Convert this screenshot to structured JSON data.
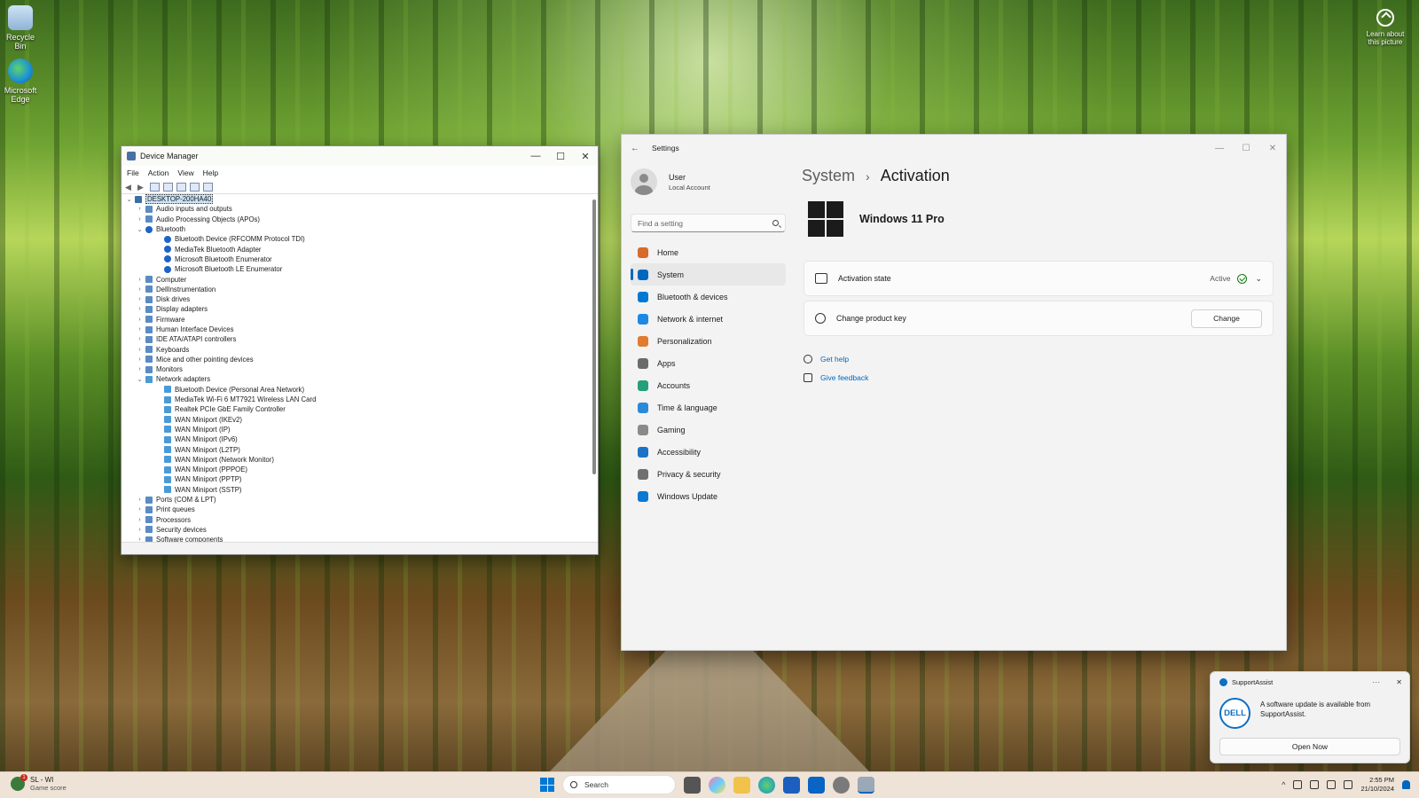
{
  "desktop": {
    "icons": [
      {
        "label": "Recycle Bin"
      },
      {
        "label": "Microsoft Edge"
      }
    ],
    "learn_label": "Learn about this picture"
  },
  "device_manager": {
    "title": "Device Manager",
    "menu": [
      "File",
      "Action",
      "View",
      "Help"
    ],
    "tree": [
      {
        "label": "DESKTOP-200HA40",
        "level": 0,
        "expanded": true,
        "kind": "root",
        "selected": true
      },
      {
        "label": "Audio inputs and outputs",
        "level": 1,
        "expanded": false,
        "kind": "dev"
      },
      {
        "label": "Audio Processing Objects (APOs)",
        "level": 1,
        "expanded": false,
        "kind": "dev"
      },
      {
        "label": "Bluetooth",
        "level": 1,
        "expanded": true,
        "kind": "bt"
      },
      {
        "label": "Bluetooth Device (RFCOMM Protocol TDI)",
        "level": 2,
        "kind": "bt"
      },
      {
        "label": "MediaTek Bluetooth Adapter",
        "level": 2,
        "kind": "bt"
      },
      {
        "label": "Microsoft Bluetooth Enumerator",
        "level": 2,
        "kind": "bt"
      },
      {
        "label": "Microsoft Bluetooth LE Enumerator",
        "level": 2,
        "kind": "bt"
      },
      {
        "label": "Computer",
        "level": 1,
        "expanded": false,
        "kind": "dev"
      },
      {
        "label": "DellInstrumentation",
        "level": 1,
        "expanded": false,
        "kind": "dev"
      },
      {
        "label": "Disk drives",
        "level": 1,
        "expanded": false,
        "kind": "dev"
      },
      {
        "label": "Display adapters",
        "level": 1,
        "expanded": false,
        "kind": "dev"
      },
      {
        "label": "Firmware",
        "level": 1,
        "expanded": false,
        "kind": "dev"
      },
      {
        "label": "Human Interface Devices",
        "level": 1,
        "expanded": false,
        "kind": "dev"
      },
      {
        "label": "IDE ATA/ATAPI controllers",
        "level": 1,
        "expanded": false,
        "kind": "dev"
      },
      {
        "label": "Keyboards",
        "level": 1,
        "expanded": false,
        "kind": "dev"
      },
      {
        "label": "Mice and other pointing devices",
        "level": 1,
        "expanded": false,
        "kind": "dev"
      },
      {
        "label": "Monitors",
        "level": 1,
        "expanded": false,
        "kind": "dev"
      },
      {
        "label": "Network adapters",
        "level": 1,
        "expanded": true,
        "kind": "net"
      },
      {
        "label": "Bluetooth Device (Personal Area Network)",
        "level": 2,
        "kind": "net"
      },
      {
        "label": "MediaTek Wi-Fi 6 MT7921 Wireless LAN Card",
        "level": 2,
        "kind": "net"
      },
      {
        "label": "Realtek PCIe GbE Family Controller",
        "level": 2,
        "kind": "net"
      },
      {
        "label": "WAN Miniport (IKEv2)",
        "level": 2,
        "kind": "net"
      },
      {
        "label": "WAN Miniport (IP)",
        "level": 2,
        "kind": "net"
      },
      {
        "label": "WAN Miniport (IPv6)",
        "level": 2,
        "kind": "net"
      },
      {
        "label": "WAN Miniport (L2TP)",
        "level": 2,
        "kind": "net"
      },
      {
        "label": "WAN Miniport (Network Monitor)",
        "level": 2,
        "kind": "net"
      },
      {
        "label": "WAN Miniport (PPPOE)",
        "level": 2,
        "kind": "net"
      },
      {
        "label": "WAN Miniport (PPTP)",
        "level": 2,
        "kind": "net"
      },
      {
        "label": "WAN Miniport (SSTP)",
        "level": 2,
        "kind": "net"
      },
      {
        "label": "Ports (COM & LPT)",
        "level": 1,
        "expanded": false,
        "kind": "dev"
      },
      {
        "label": "Print queues",
        "level": 1,
        "expanded": false,
        "kind": "dev"
      },
      {
        "label": "Processors",
        "level": 1,
        "expanded": false,
        "kind": "dev"
      },
      {
        "label": "Security devices",
        "level": 1,
        "expanded": false,
        "kind": "dev"
      },
      {
        "label": "Software components",
        "level": 1,
        "expanded": false,
        "kind": "dev"
      }
    ]
  },
  "settings": {
    "title": "Settings",
    "user": {
      "name": "User",
      "account": "Local Account"
    },
    "search_placeholder": "Find a setting",
    "nav": [
      {
        "label": "Home",
        "icon": "home-icon",
        "color": "#d86a2a"
      },
      {
        "label": "System",
        "icon": "system-icon",
        "color": "#0067c0",
        "active": true
      },
      {
        "label": "Bluetooth & devices",
        "icon": "bluetooth-icon",
        "color": "#0078d4"
      },
      {
        "label": "Network & internet",
        "icon": "wifi-icon",
        "color": "#1e88e5"
      },
      {
        "label": "Personalization",
        "icon": "brush-icon",
        "color": "#e07b30"
      },
      {
        "label": "Apps",
        "icon": "apps-icon",
        "color": "#6b6b6b"
      },
      {
        "label": "Accounts",
        "icon": "accounts-icon",
        "color": "#25a07a"
      },
      {
        "label": "Time & language",
        "icon": "globe-clock-icon",
        "color": "#2b8ad8"
      },
      {
        "label": "Gaming",
        "icon": "gamepad-icon",
        "color": "#8a8a8a"
      },
      {
        "label": "Accessibility",
        "icon": "accessibility-icon",
        "color": "#1a73c8"
      },
      {
        "label": "Privacy & security",
        "icon": "shield-icon",
        "color": "#707070"
      },
      {
        "label": "Windows Update",
        "icon": "update-icon",
        "color": "#0a78d4"
      }
    ],
    "breadcrumb": {
      "parent": "System",
      "separator": "›",
      "current": "Activation"
    },
    "edition": "Windows 11 Pro",
    "activation_state": {
      "label": "Activation state",
      "value": "Active"
    },
    "product_key": {
      "label": "Change product key",
      "button": "Change"
    },
    "links": {
      "help": "Get help",
      "feedback": "Give feedback"
    }
  },
  "toast": {
    "app": "SupportAssist",
    "logo": "DELL",
    "message": "A software update is available from SupportAssist.",
    "button": "Open Now"
  },
  "taskbar": {
    "weather_title": "SL - WI",
    "weather_sub": "Game score",
    "search_placeholder": "Search",
    "time": "2:55 PM",
    "date": "21/10/2024"
  }
}
